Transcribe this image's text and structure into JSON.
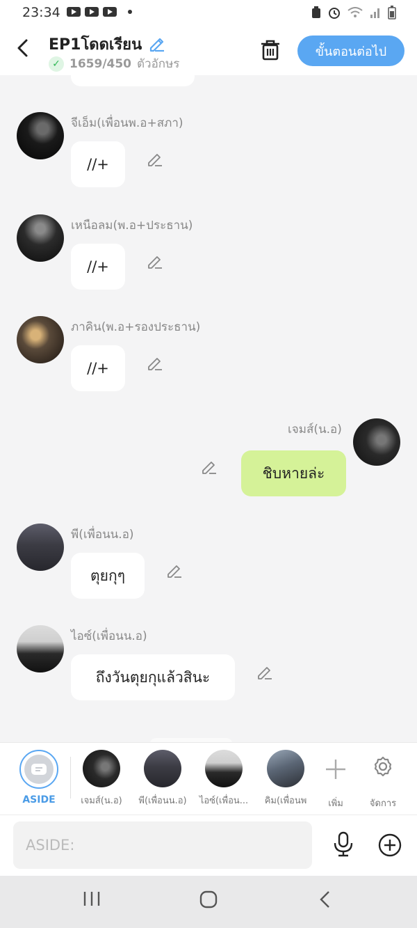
{
  "status_bar": {
    "time": "23:34",
    "left_icons": [
      "youtube-icon",
      "youtube-icon",
      "youtube-icon",
      "notification-dot"
    ],
    "right_icons": [
      "recycle-icon",
      "alarm-icon",
      "wifi-icon",
      "signal-icon",
      "battery-icon"
    ]
  },
  "header": {
    "title": "EP1โดดเรียน",
    "char_count": "1659/450",
    "char_unit": "ตัวอักษร",
    "next_button": "ขั้นตอนต่อไป"
  },
  "messages": [
    {
      "sender": "จีเอ็ม(เพื่อนพ.อ+สภา)",
      "text": "//+",
      "side": "left"
    },
    {
      "sender": "เหนือลม(พ.อ+ประธาน)",
      "text": "//+",
      "side": "left"
    },
    {
      "sender": "ภาคิน(พ.อ+รองประธาน)",
      "text": "//+",
      "side": "left"
    },
    {
      "sender": "เจมส์(น.อ)",
      "text": "ชิบหายล่ะ",
      "side": "right"
    },
    {
      "sender": "พี(เพื่อนน.อ)",
      "text": "ตุยกุๆ",
      "side": "left"
    },
    {
      "sender": "ไอซ์(เพื่อนน.อ)",
      "text": "ถึงวันตุยกุแล้วสินะ",
      "side": "left"
    }
  ],
  "character_bar": {
    "aside_label": "ASIDE",
    "characters": [
      "เจมส์(น.อ)",
      "พี(เพื่อนน.อ)",
      "ไอซ์(เพื่อน...",
      "คิม(เพื่อนพ"
    ],
    "add_label": "เพิ่ม",
    "manage_label": "จัดการ"
  },
  "input": {
    "placeholder": "ASIDE:"
  },
  "colors": {
    "accent": "#5aa7f2",
    "my_bubble": "#d5f298",
    "background": "#f4f4f5"
  }
}
